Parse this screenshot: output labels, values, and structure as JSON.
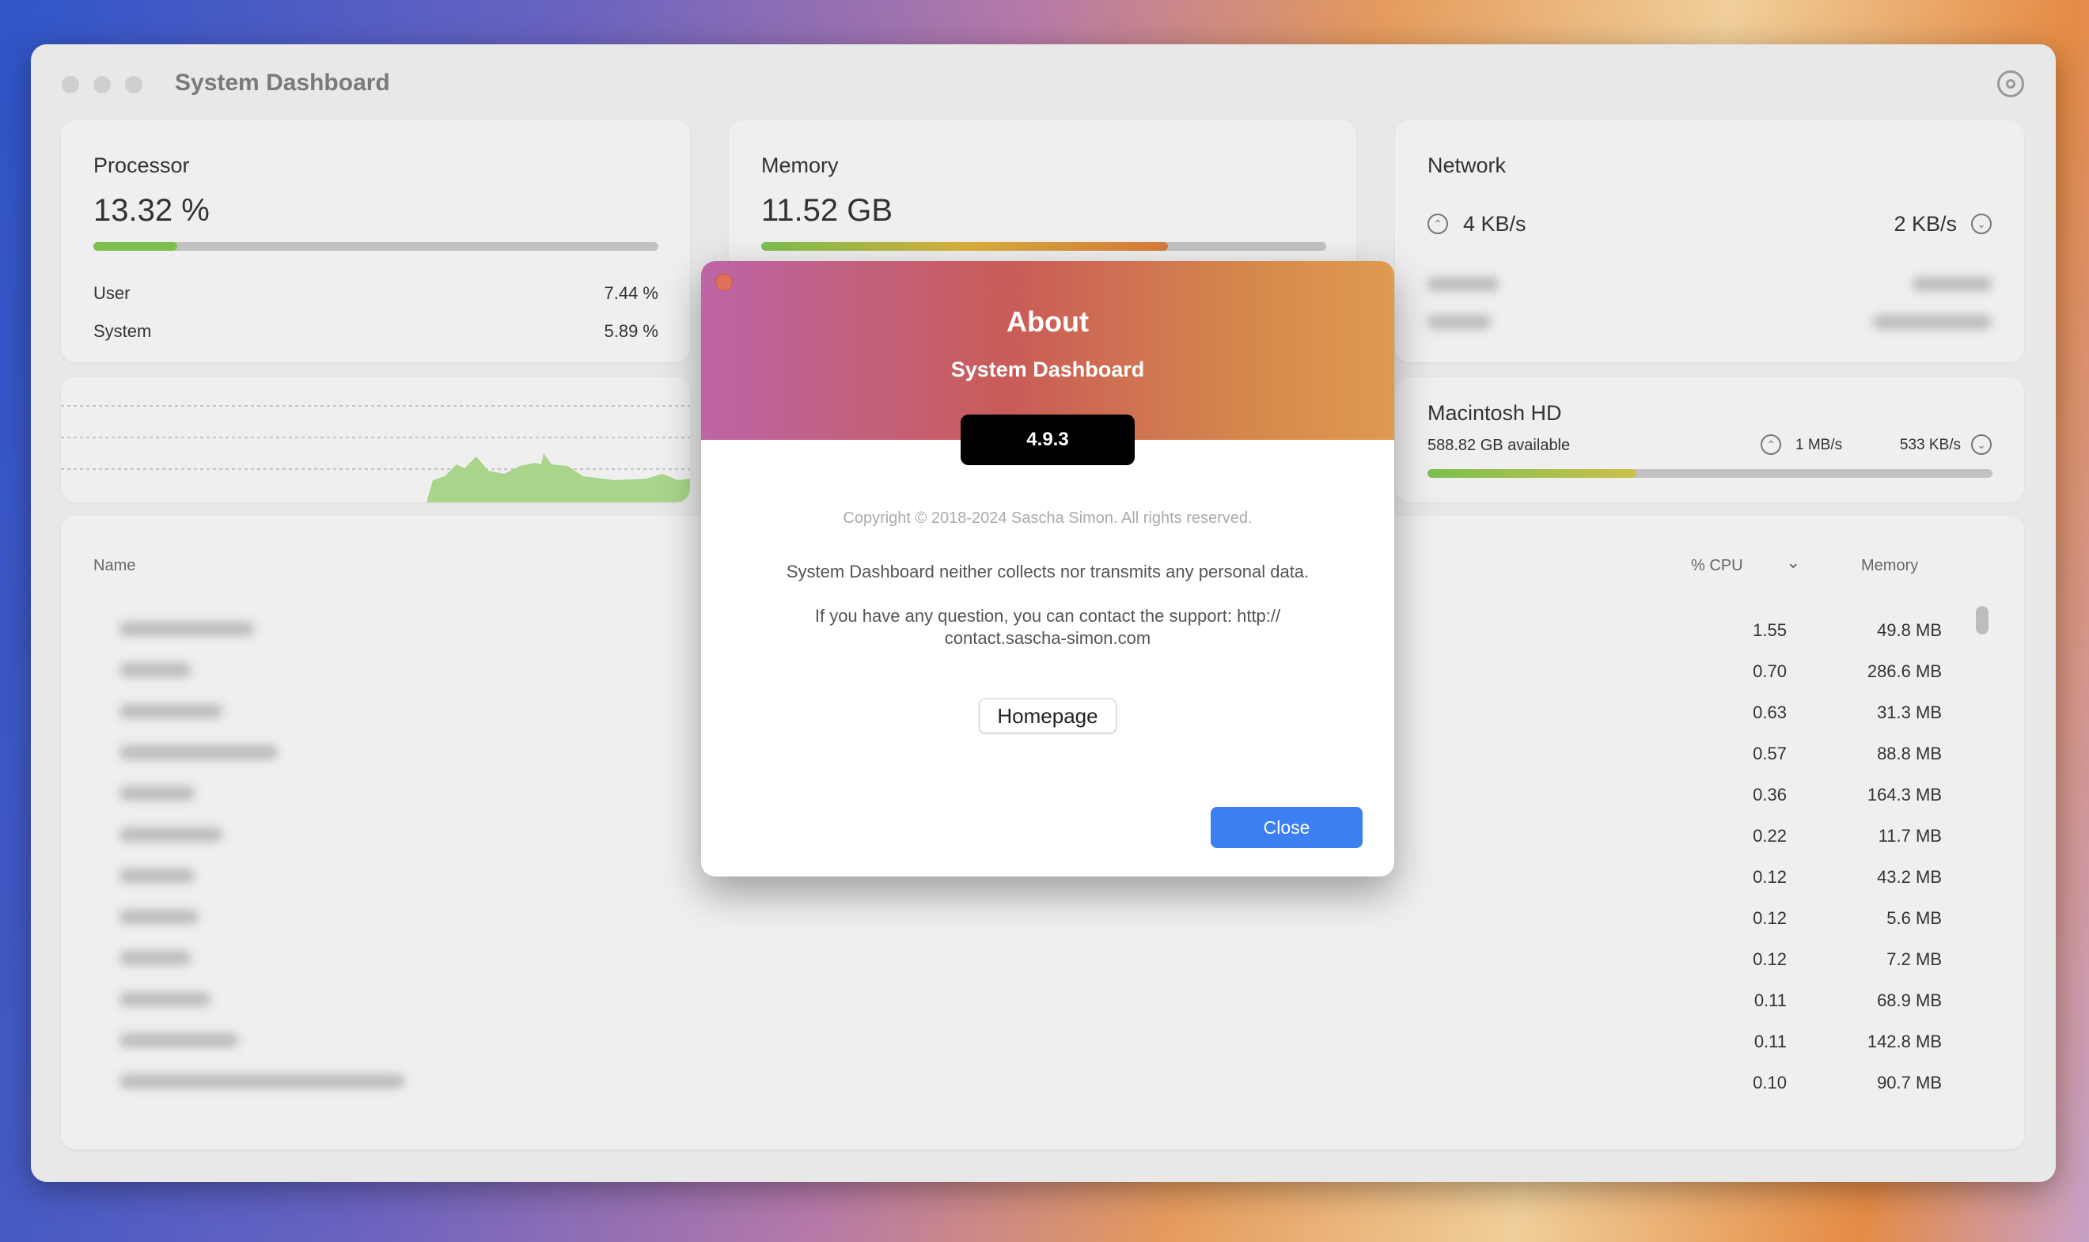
{
  "window": {
    "title": "System Dashboard",
    "settings_icon": "gear-icon"
  },
  "processor": {
    "label": "Processor",
    "value": "13.32 %",
    "usage_percent": 13.32,
    "user_label": "User",
    "user_value": "7.44 %",
    "system_label": "System",
    "system_value": "5.89 %"
  },
  "memory": {
    "label": "Memory",
    "value": "11.52 GB",
    "usage_percent": 72
  },
  "network": {
    "label": "Network",
    "upload": "4 KB/s",
    "download": "2 KB/s"
  },
  "disk": {
    "label": "Macintosh HD",
    "available": "588.82 GB available",
    "read": "1 MB/s",
    "write": "533 KB/s",
    "used_percent": 37
  },
  "table": {
    "col_name": "Name",
    "col_cpu": "% CPU",
    "col_memory": "Memory",
    "rows": [
      {
        "cpu": "1.55",
        "mem": "49.8 MB"
      },
      {
        "cpu": "0.70",
        "mem": "286.6 MB"
      },
      {
        "cpu": "0.63",
        "mem": "31.3 MB"
      },
      {
        "cpu": "0.57",
        "mem": "88.8 MB"
      },
      {
        "cpu": "0.36",
        "mem": "164.3 MB"
      },
      {
        "cpu": "0.22",
        "mem": "11.7 MB"
      },
      {
        "cpu": "0.12",
        "mem": "43.2 MB"
      },
      {
        "cpu": "0.12",
        "mem": "5.6 MB"
      },
      {
        "cpu": "0.12",
        "mem": "7.2 MB"
      },
      {
        "cpu": "0.11",
        "mem": "68.9 MB"
      },
      {
        "cpu": "0.11",
        "mem": "142.8 MB"
      },
      {
        "cpu": "0.10",
        "mem": "90.7 MB"
      }
    ]
  },
  "about": {
    "title": "About",
    "app_name": "System Dashboard",
    "version": "4.9.3",
    "copyright": "Copyright © 2018-2024 Sascha Simon. All rights reserved.",
    "privacy": "System Dashboard neither collects nor transmits any personal data.",
    "support_line1": "If you have any question, you can contact the support: http://",
    "support_line2": "contact.sascha-simon.com",
    "homepage_button": "Homepage",
    "close_button": "Close"
  },
  "colors": {
    "accent": "#3b7ff0",
    "progress_green": "#7cc04f"
  }
}
